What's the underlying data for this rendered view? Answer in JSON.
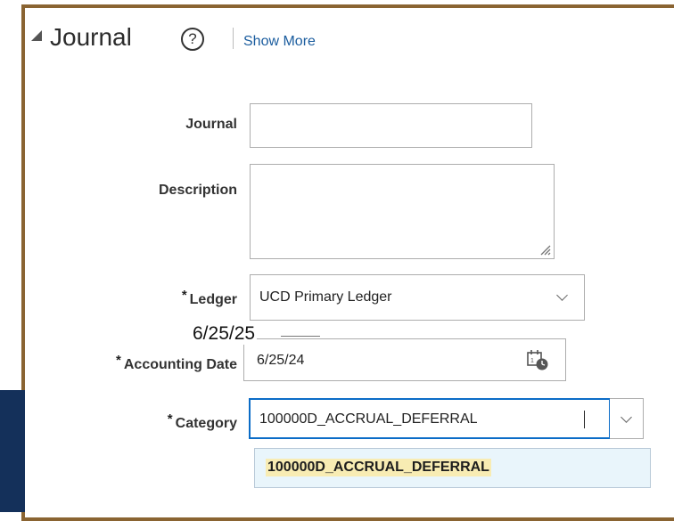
{
  "section": {
    "title": "Journal",
    "help_glyph": "?",
    "show_more": "Show More",
    "collapse_icon": "triangle-collapse-icon"
  },
  "fields": {
    "journal": {
      "label": "Journal",
      "value": ""
    },
    "description": {
      "label": "Description",
      "value": ""
    },
    "ledger": {
      "required_mark": "*",
      "label": "Ledger",
      "value": "UCD Primary Ledger"
    },
    "accounting_date": {
      "required_mark": "*",
      "label": "Accounting Date",
      "value": "6/25/24",
      "icon": "calendar-icon"
    },
    "category": {
      "required_mark": "*",
      "label": "Category",
      "value": "100000D_ACCRUAL_DEFERRAL"
    }
  },
  "dropdown": {
    "options": [
      "100000D_ACCRUAL_DEFERRAL"
    ]
  },
  "annotation": {
    "text": "6/25/25"
  },
  "colors": {
    "frame_border": "#8a6432",
    "navy_block": "#14305a",
    "focus_border": "#0b6cc7",
    "link": "#1a5c9e",
    "highlight": "#f8ecb3"
  }
}
